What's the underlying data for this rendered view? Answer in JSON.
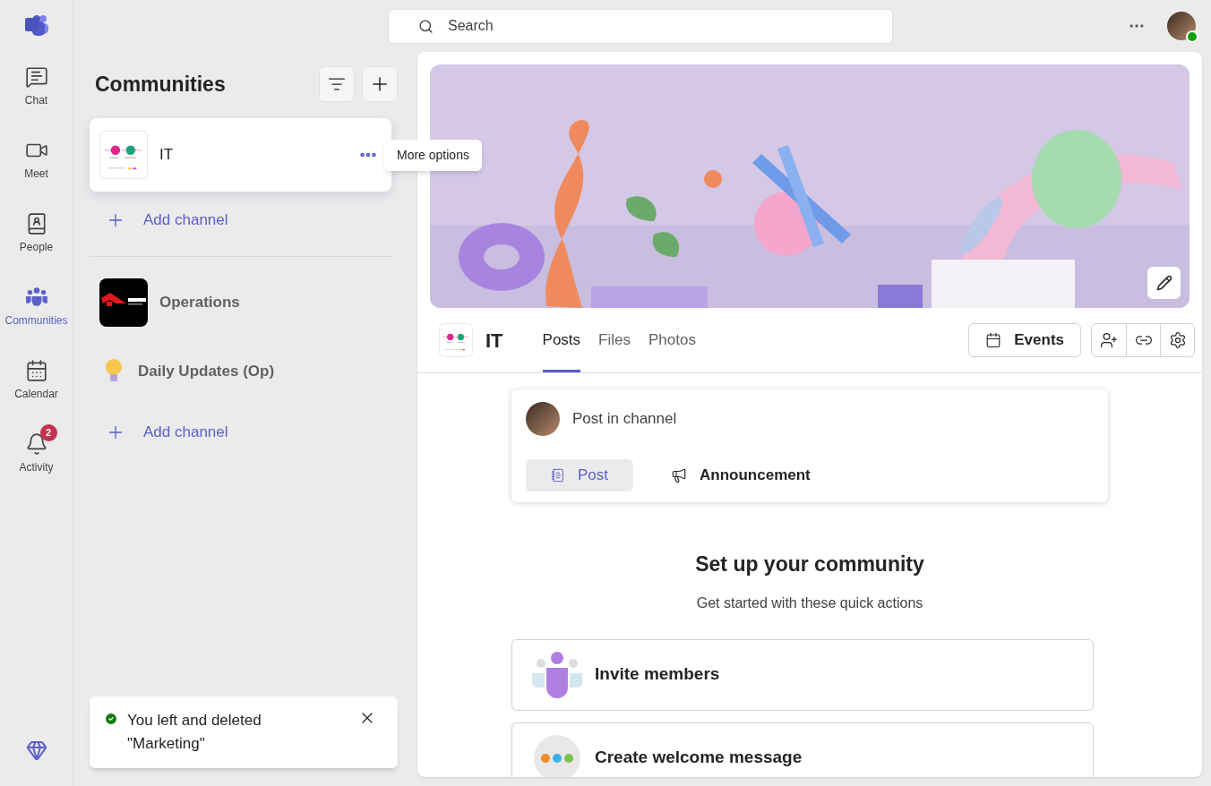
{
  "rail": [
    {
      "label": "Chat",
      "selected": false
    },
    {
      "label": "Meet",
      "selected": false
    },
    {
      "label": "People",
      "selected": false
    },
    {
      "label": "Communities",
      "selected": true
    },
    {
      "label": "Calendar",
      "selected": false
    },
    {
      "label": "Activity",
      "selected": false,
      "badge": "2"
    }
  ],
  "search": {
    "placeholder": "Search"
  },
  "communities": {
    "title": "Communities",
    "groups": [
      {
        "name": "IT",
        "selected": true,
        "channels": [
          {
            "kind": "add",
            "label": "Add channel"
          }
        ]
      },
      {
        "name": "Operations",
        "selected": false,
        "channels": [
          {
            "kind": "channel",
            "label": "Daily Updates (Op)"
          },
          {
            "kind": "add",
            "label": "Add channel"
          }
        ]
      }
    ]
  },
  "tooltip": "More options",
  "toast": {
    "message": "You left and deleted \"Marketing\""
  },
  "community": {
    "name": "IT",
    "tabs": [
      {
        "label": "Posts",
        "selected": true
      },
      {
        "label": "Files",
        "selected": false
      },
      {
        "label": "Photos",
        "selected": false
      }
    ],
    "events_button": "Events"
  },
  "composer": {
    "placeholder": "Post in channel",
    "modes": [
      {
        "label": "Post",
        "selected": true
      },
      {
        "label": "Announcement",
        "selected": false
      }
    ]
  },
  "setup": {
    "title": "Set up your community",
    "subtitle": "Get started with these quick actions",
    "actions": [
      {
        "kind": "invite",
        "label": "Invite members"
      },
      {
        "kind": "welcome",
        "label": "Create welcome message"
      }
    ]
  }
}
